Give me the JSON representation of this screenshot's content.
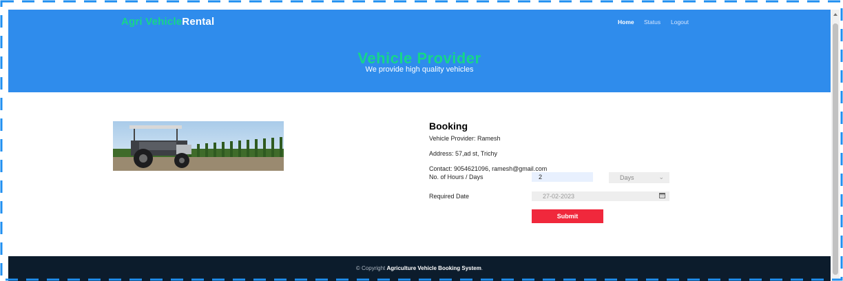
{
  "brand": {
    "part1": "Agri Vehicle",
    "part2": "Rental"
  },
  "nav": {
    "home": "Home",
    "status": "Status",
    "logout": "Logout"
  },
  "hero": {
    "title": "Vehicle Provider",
    "subtitle": "We provide high quality vehicles"
  },
  "booking": {
    "title": "Booking",
    "provider": "Vehicle Provider: Ramesh",
    "address": "Address: 57,ad st, Trichy",
    "contact": "Contact: 9054621096, ramesh@gmail.com",
    "hours_label": "No. of Hours / Days",
    "hours_value": "2",
    "unit_value": "Days",
    "date_label": "Required Date",
    "date_value": "27-02-2023",
    "submit_label": "Submit"
  },
  "footer": {
    "prefix": "© Copyright ",
    "name": "Agriculture Vehicle Booking System",
    "suffix": "."
  },
  "colors": {
    "hero": "#2f8cec",
    "accent": "#16d68a",
    "submit": "#f0283c",
    "footer": "#0c1c2c",
    "frame": "#1f8ff0"
  }
}
